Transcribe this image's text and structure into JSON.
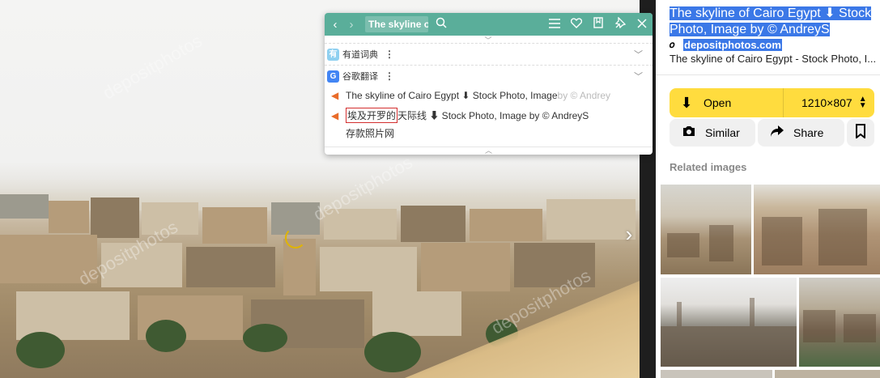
{
  "photo": {
    "watermarks": [
      "depositphotos",
      "depositphotos",
      "depositphotos",
      "depositphotos"
    ],
    "next_icon": "chevron-right"
  },
  "translator": {
    "query": "The skyline o",
    "header_icons": [
      "back-arrow",
      "forward-arrow",
      "search",
      "menu",
      "heart",
      "bookmark",
      "pin",
      "close"
    ],
    "engines": [
      {
        "name": "有道词典",
        "icon": "youdao"
      },
      {
        "name": "谷歌翻译",
        "icon": "google-translate"
      }
    ],
    "source_text_strong": "The skyline of Cairo Egypt ⬇ Stock Photo, Image",
    "source_text_faded": " by © Andrey",
    "translation_highlight": "埃及开罗的",
    "translation_rest": "天际线 ⬇ Stock Photo, Image by © AndreyS",
    "translation_line2": "存款照片网"
  },
  "panel": {
    "title": "The skyline of Cairo Egypt ⬇ Stock Photo, Image by © AndreyS",
    "source": "depositphotos.com",
    "description": "The skyline of Cairo Egypt - Stock Photo, I...",
    "open_label": "Open",
    "size_label": "1210×807",
    "similar_label": "Similar",
    "share_label": "Share",
    "related_title": "Related images",
    "colors": {
      "accent_yellow": "#ffdc3e",
      "selection_blue": "#3b78e7",
      "translator_green": "#5aae9a"
    }
  }
}
